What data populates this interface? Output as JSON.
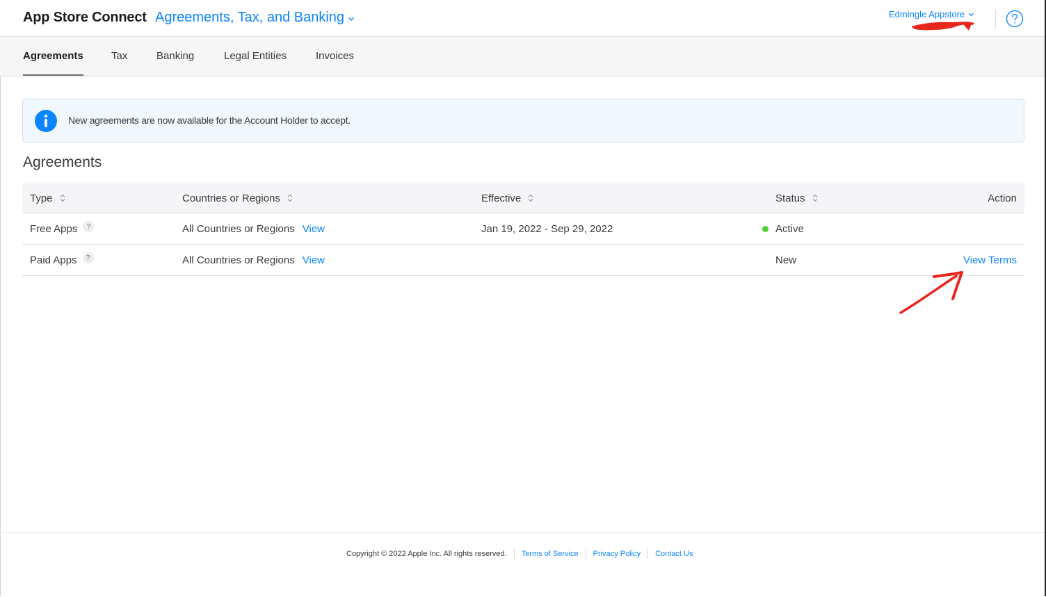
{
  "header": {
    "app_title": "App Store Connect",
    "section_menu_label": "Agreements, Tax, and Banking",
    "account_name": "Edmingle Appstore"
  },
  "tabs": [
    {
      "label": "Agreements",
      "active": true
    },
    {
      "label": "Tax",
      "active": false
    },
    {
      "label": "Banking",
      "active": false
    },
    {
      "label": "Legal Entities",
      "active": false
    },
    {
      "label": "Invoices",
      "active": false
    }
  ],
  "notice": {
    "message": "New agreements are now available for the Account Holder to accept."
  },
  "agreements": {
    "heading": "Agreements",
    "columns": {
      "type": "Type",
      "countries": "Countries or Regions",
      "effective": "Effective",
      "status": "Status",
      "action": "Action"
    },
    "rows": [
      {
        "type": "Free Apps",
        "help": "?",
        "countries": "All Countries or Regions",
        "view_label": "View",
        "effective": "Jan 19, 2022 - Sep 29, 2022",
        "status": "Active",
        "status_color": "#4cd137",
        "action": ""
      },
      {
        "type": "Paid Apps",
        "help": "?",
        "countries": "All Countries or Regions",
        "view_label": "View",
        "effective": "",
        "status": "New",
        "action": "View Terms"
      }
    ]
  },
  "footer": {
    "copyright": "Copyright © 2022 Apple Inc. All rights reserved.",
    "links": [
      "Terms of Service",
      "Privacy Policy",
      "Contact Us"
    ]
  },
  "colors": {
    "accent": "#0a84ff",
    "annotation": "#e8261c"
  }
}
